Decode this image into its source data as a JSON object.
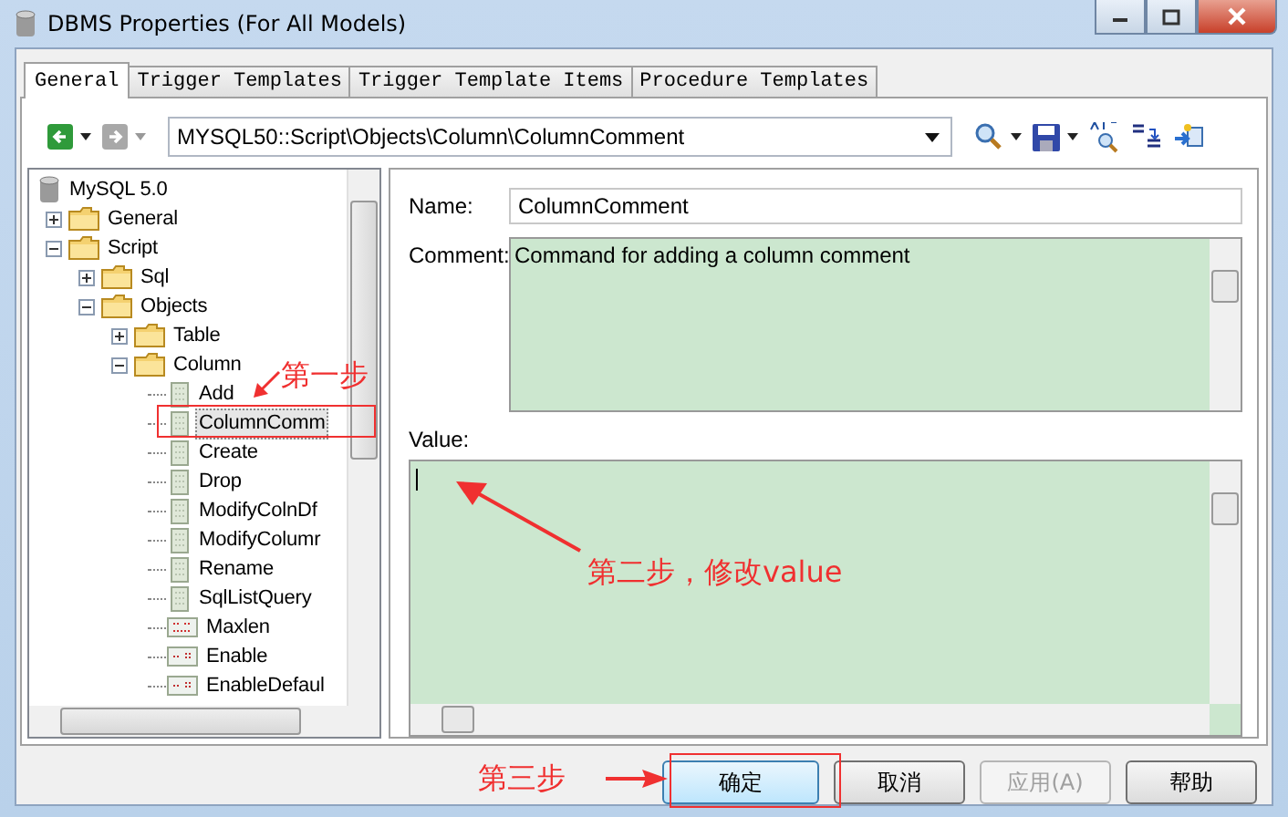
{
  "window": {
    "title": "DBMS Properties (For All Models)"
  },
  "tabs": [
    {
      "label": "General",
      "selected": true
    },
    {
      "label": "Trigger Templates",
      "selected": false
    },
    {
      "label": "Trigger Template Items",
      "selected": false
    },
    {
      "label": "Procedure Templates",
      "selected": false
    }
  ],
  "toolbar": {
    "path": "MYSQL50::Script\\Objects\\Column\\ColumnComment"
  },
  "tree": {
    "items": [
      {
        "label": "MySQL 5.0",
        "kind": "database",
        "selected": false,
        "children": [
          {
            "label": "General",
            "kind": "folder",
            "expanded": false,
            "selected": false
          },
          {
            "label": "Script",
            "kind": "folder",
            "expanded": true,
            "selected": false,
            "children": [
              {
                "label": "Sql",
                "kind": "folder",
                "expanded": false,
                "selected": false
              },
              {
                "label": "Objects",
                "kind": "folder",
                "expanded": true,
                "selected": false,
                "children": [
                  {
                    "label": "Table",
                    "kind": "folder",
                    "expanded": false,
                    "selected": false
                  },
                  {
                    "label": "Column",
                    "kind": "folder",
                    "expanded": true,
                    "selected": false,
                    "children": [
                      {
                        "label": "Add",
                        "kind": "script",
                        "selected": false
                      },
                      {
                        "label": "ColumnComm",
                        "kind": "script",
                        "selected": true
                      },
                      {
                        "label": "Create",
                        "kind": "script",
                        "selected": false
                      },
                      {
                        "label": "Drop",
                        "kind": "script",
                        "selected": false
                      },
                      {
                        "label": "ModifyColnDf",
                        "kind": "script",
                        "selected": false
                      },
                      {
                        "label": "ModifyColumr",
                        "kind": "script",
                        "selected": false
                      },
                      {
                        "label": "Rename",
                        "kind": "script",
                        "selected": false
                      },
                      {
                        "label": "SqlListQuery",
                        "kind": "script",
                        "selected": false
                      },
                      {
                        "label": "Maxlen",
                        "kind": "number",
                        "selected": false
                      },
                      {
                        "label": "Enable",
                        "kind": "flag",
                        "selected": false
                      },
                      {
                        "label": "EnableDefaul",
                        "kind": "flag",
                        "selected": false
                      }
                    ]
                  }
                ]
              }
            ]
          }
        ]
      }
    ]
  },
  "form": {
    "name_label": "Name:",
    "name_value": "ColumnComment",
    "comment_label": "Comment:",
    "comment_value": "Command for adding a column comment",
    "value_label": "Value:"
  },
  "buttons": [
    {
      "label": "确定",
      "default": true,
      "disabled": false
    },
    {
      "label": "取消",
      "default": false,
      "disabled": false
    },
    {
      "label": "应用(A)",
      "default": false,
      "disabled": true
    },
    {
      "label": "帮助",
      "default": false,
      "disabled": false
    }
  ],
  "annotations": [
    {
      "text": "第一步"
    },
    {
      "text": "第二步，修改value"
    },
    {
      "text": "第三步"
    }
  ]
}
